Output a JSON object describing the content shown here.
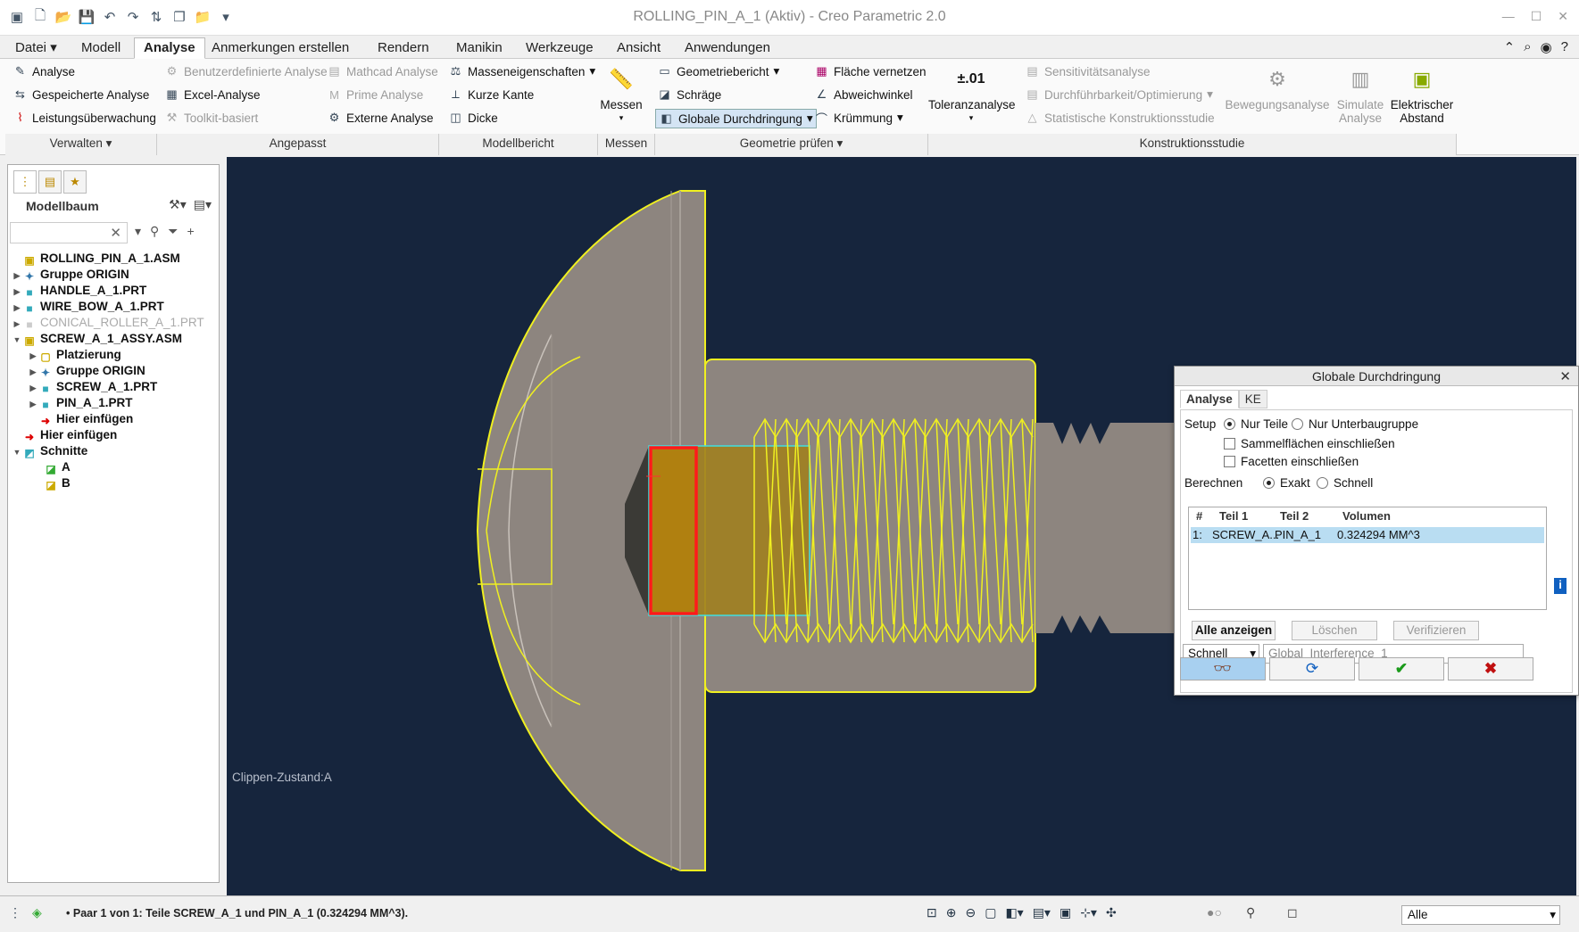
{
  "window": {
    "title": "ROLLING_PIN_A_1 (Aktiv) - Creo Parametric 2.0"
  },
  "menu": {
    "tabs": [
      "Datei",
      "Modell",
      "Analyse",
      "Anmerkungen erstellen",
      "Rendern",
      "Manikin",
      "Werkzeuge",
      "Ansicht",
      "Anwendungen"
    ],
    "active": "Analyse"
  },
  "ribbon": {
    "verwalten": {
      "analyse": "Analyse",
      "gespeicherte": "Gespeicherte Analyse",
      "leistung": "Leistungsüberwachung",
      "group": "Verwalten"
    },
    "angepasst": {
      "benutzer": "Benutzerdefinierte Analyse",
      "excel": "Excel-Analyse",
      "toolkit": "Toolkit-basiert",
      "mathcad": "Mathcad Analyse",
      "prime": "Prime Analyse",
      "externe": "Externe Analyse",
      "group": "Angepasst"
    },
    "modellbericht": {
      "masse": "Masseneigenschaften",
      "kante": "Kurze Kante",
      "dicke": "Dicke",
      "group": "Modellbericht"
    },
    "messen": {
      "label": "Messen",
      "group": "Messen"
    },
    "geometrie": {
      "bericht": "Geometriebericht",
      "schraege": "Schräge",
      "global": "Globale Durchdringung",
      "flaeche": "Fläche vernetzen",
      "abweich": "Abweichwinkel",
      "kruemmung": "Krümmung",
      "group": "Geometrie prüfen"
    },
    "konstruktion": {
      "toleranz": "Toleranzanalyse",
      "toleranz_icon": "±.01",
      "sens": "Sensitivitätsanalyse",
      "durch": "Durchführbarkeit/Optimierung",
      "stat": "Statistische Konstruktionsstudie",
      "beweg": "Bewegungsanalyse",
      "simulate1": "Simulate",
      "simulate2": "Analyse",
      "elek1": "Elektrischer",
      "elek2": "Abstand",
      "group": "Konstruktionsstudie"
    }
  },
  "modeltree": {
    "title": "Modellbaum",
    "items": [
      {
        "label": "ROLLING_PIN_A_1.ASM"
      },
      {
        "label": "Gruppe ORIGIN"
      },
      {
        "label": "HANDLE_A_1.PRT"
      },
      {
        "label": "WIRE_BOW_A_1.PRT"
      },
      {
        "label": "CONICAL_ROLLER_A_1.PRT"
      },
      {
        "label": "SCREW_A_1_ASSY.ASM"
      },
      {
        "label": "Platzierung"
      },
      {
        "label": "Gruppe ORIGIN"
      },
      {
        "label": "SCREW_A_1.PRT"
      },
      {
        "label": "PIN_A_1.PRT"
      },
      {
        "label": "Hier einfügen"
      },
      {
        "label": "Hier einfügen"
      },
      {
        "label": "Schnitte"
      },
      {
        "label": "A"
      },
      {
        "label": "B"
      }
    ]
  },
  "viewport": {
    "clip_state": "Clippen-Zustand:A",
    "background": "#16253d"
  },
  "dialog": {
    "title": "Globale Durchdringung",
    "tabs": [
      "Analyse",
      "KE"
    ],
    "setup_label": "Setup",
    "opt_nur_teile": "Nur Teile",
    "opt_nur_unter": "Nur Unterbaugruppe",
    "cb_sammel": "Sammelflächen einschließen",
    "cb_facetten": "Facetten einschließen",
    "berechnen_label": "Berechnen",
    "opt_exakt": "Exakt",
    "opt_schnell": "Schnell",
    "columns": [
      "#",
      "Teil 1",
      "Teil 2",
      "Volumen"
    ],
    "rows": [
      {
        "num": "1:",
        "teil1": "SCREW_A...",
        "teil2": "PIN_A_1",
        "vol": "0.324294 MM^3"
      }
    ],
    "btn_alle": "Alle anzeigen",
    "btn_loeschen": "Löschen",
    "btn_verif": "Verifizieren",
    "mode": "Schnell",
    "name": "Global_Interference_1"
  },
  "status": {
    "message": "Paar 1 von 1: Teile SCREW_A_1 und PIN_A_1 (0.324294 MM^3).",
    "filter": "Alle"
  }
}
